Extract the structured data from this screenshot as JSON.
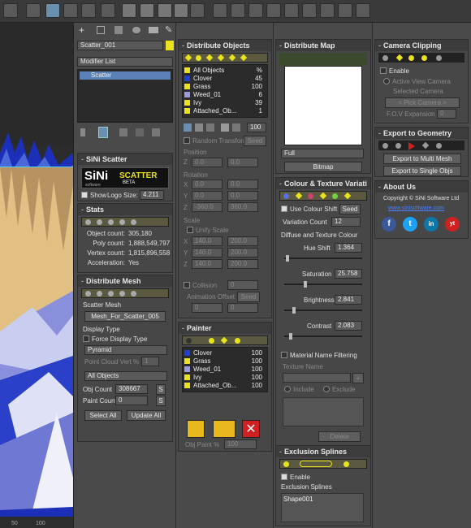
{
  "cmd": {
    "object_name": "Scatter_001",
    "modifier_list": "Modifier List",
    "stack_item": "Scatter"
  },
  "sini_scatter": {
    "title": "SiNi Scatter",
    "logo_main": "SiNi",
    "logo_sub": "software",
    "logo_scatter": "SCATTER",
    "logo_beta": "BETA",
    "show": "Show",
    "logo_size_label": "Logo Size:",
    "logo_size": "4.211"
  },
  "stats": {
    "title": "Stats",
    "object_count_label": "Object count:",
    "object_count": "305,180",
    "poly_count_label": "Poly count:",
    "poly_count": "1,888,549,797",
    "vertex_count_label": "Vertex count:",
    "vertex_count": "1,815,896,558",
    "accel_label": "Acceleration:",
    "accel": "Yes"
  },
  "distribute_mesh": {
    "title": "Distribute Mesh",
    "scatter_mesh_label": "Scatter Mesh",
    "scatter_mesh": "Mesh_For_Scatter_005",
    "display_type_label": "Display Type",
    "force_display": "Force Display Type",
    "display_type": "Pyramid",
    "point_cloud": "Point Cloud Vert %",
    "point_cloud_val": "1",
    "all_objects": "All Objects",
    "obj_count_label": "Obj Count",
    "obj_count": "308667",
    "paint_count_label": "Paint Count",
    "paint_count": "0",
    "s": "S",
    "select_all": "Select All",
    "update_all": "Update All"
  },
  "distribute_objects": {
    "title": "Distribute Objects",
    "items": [
      {
        "name": "All Objects",
        "value": "%",
        "color": "#e8e31c"
      },
      {
        "name": "Clover",
        "value": "45",
        "color": "#2140d0"
      },
      {
        "name": "Grass",
        "value": "100",
        "color": "#e8e31c"
      },
      {
        "name": "Weed_01",
        "value": "6",
        "color": "#9a9ae0"
      },
      {
        "name": "Ivy",
        "value": "39",
        "color": "#e8e31c"
      },
      {
        "name": "Attached_Ob...",
        "value": "1",
        "color": "#e8e31c"
      }
    ],
    "spin_val": "100",
    "random_transform": "Random Transform",
    "seed": "Seed",
    "position": "Position",
    "rotation": "Rotation",
    "scale": "Scale",
    "uniform_scale": "Unify Scale",
    "collision": "Collision",
    "collision_val": "0",
    "anim_offset": "Animation Offset",
    "x": "X",
    "y": "Y",
    "z": "Z",
    "pos_vals": [
      [
        "0.0",
        "0.0"
      ],
      [
        "0.0",
        "0.0"
      ]
    ],
    "rot_vals": [
      [
        "0.0",
        "0.0"
      ],
      [
        "0.0",
        "0.0"
      ],
      [
        "-360.0",
        "360.0"
      ]
    ],
    "scl_vals": [
      [
        "140.0",
        "200.0"
      ],
      [
        "140.0",
        "200.0"
      ],
      [
        "140.0",
        "200.0"
      ]
    ],
    "anim_vals": [
      "0",
      "0"
    ]
  },
  "painter": {
    "title": "Painter",
    "items": [
      {
        "name": "Clover",
        "value": "100",
        "color": "#2140d0"
      },
      {
        "name": "Grass",
        "value": "100",
        "color": "#e8e31c"
      },
      {
        "name": "Weed_01",
        "value": "100",
        "color": "#9a9ae0"
      },
      {
        "name": "Ivy",
        "value": "100",
        "color": "#e8e31c"
      },
      {
        "name": "Attached_Ob...",
        "value": "100",
        "color": "#e8e31c"
      }
    ],
    "obj_paint_label": "Obj Paint %",
    "obj_paint": "100"
  },
  "distribute_map": {
    "title": "Distribute Map",
    "dropdown": "Full",
    "bitmap": "Bitmap"
  },
  "colour": {
    "title": "Colour & Texture Variati",
    "use_colour_shift": "Use Colour Shift",
    "seed": "Seed",
    "variation_count_label": "Variation Count",
    "variation_count": "12",
    "diffuse": "Diffuse and Texture Colour",
    "hue_label": "Hue Shift",
    "hue": "1.364",
    "sat_label": "Saturation",
    "sat": "25.758",
    "bri_label": "Brightness",
    "bri": "2.841",
    "con_label": "Contrast",
    "con": "2.083",
    "material_filter": "Material Name Filtering",
    "texture_name": "Texture Name",
    "include": "Include",
    "exclude": "Exclude",
    "delete": "Delete"
  },
  "exclusion": {
    "title": "Exclusion Splines",
    "enable": "Enable",
    "label": "Exclusion Splines",
    "item": "Shape001"
  },
  "camera": {
    "title": "Camera Clipping",
    "enable": "Enable",
    "active_view": "Active View Camera",
    "selected_camera": "Selected Camera",
    "pick_camera": "< Pick Camera >",
    "fov_label": "F.O.V Expansion",
    "fov": "0"
  },
  "export": {
    "title": "Export to Geometry",
    "multi": "Export to Multi Mesh",
    "single": "Export to Single Objs"
  },
  "about": {
    "title": "About Us",
    "copyright": "Copyright © SiNi Software Ltd",
    "link": "www.sinisoftware.com",
    "social": [
      "f",
      "t",
      "in",
      "yt"
    ]
  },
  "ruler": [
    "50",
    "100"
  ],
  "colors": {
    "yellow": "#e8e31c",
    "blue_hl": "#6a8fb0",
    "red": "#d02020"
  }
}
